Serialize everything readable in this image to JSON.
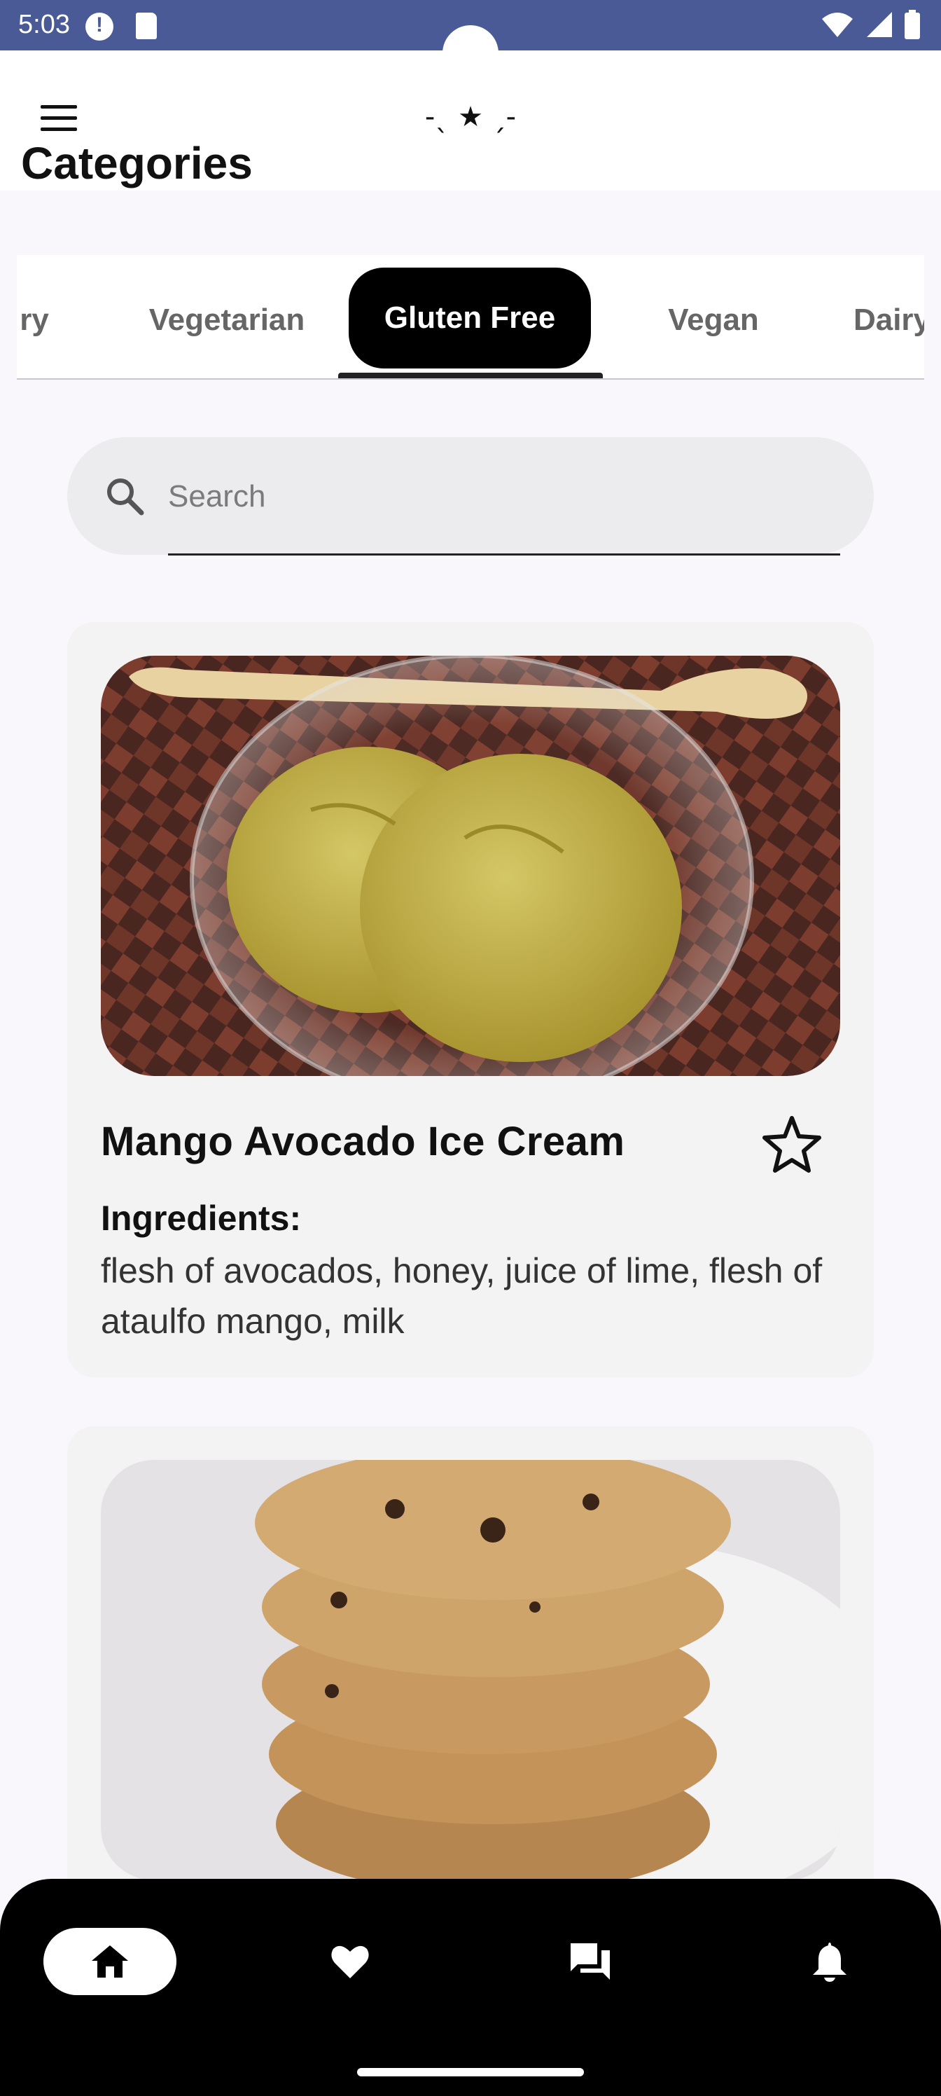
{
  "status_bar": {
    "time": "5:03",
    "icons": [
      "alert-icon",
      "sd-card-icon",
      "wifi-icon",
      "signal-icon",
      "battery-icon"
    ]
  },
  "app_bar": {
    "menu_icon": "menu-icon",
    "logo_text": "-ˎ ★ ˏ-"
  },
  "categories": {
    "title": "Categories",
    "tabs": [
      {
        "label": "ry",
        "active": false
      },
      {
        "label": "Vegetarian",
        "active": false
      },
      {
        "label": "Gluten Free",
        "active": true
      },
      {
        "label": "Vegan",
        "active": false
      },
      {
        "label": "Dairy",
        "active": false
      }
    ]
  },
  "search": {
    "placeholder": "Search",
    "icon": "search-icon"
  },
  "recipes": [
    {
      "title": "Mango Avocado Ice Cream",
      "ingredients_label": "Ingredients:",
      "ingredients": "flesh of avocados, honey, juice of lime, flesh of ataulfo mango, milk",
      "favorite_icon": "star-outline-icon"
    },
    {
      "title": "",
      "ingredients_label": "",
      "ingredients": "",
      "favorite_icon": ""
    }
  ],
  "bottom_nav": {
    "items": [
      {
        "icon": "home-icon",
        "active": true
      },
      {
        "icon": "heart-icon",
        "active": false
      },
      {
        "icon": "chat-icon",
        "active": false
      },
      {
        "icon": "bell-icon",
        "active": false
      }
    ]
  },
  "colors": {
    "status_bar": "#4a5a96",
    "active_tab": "#000000",
    "card_bg": "#f3f3f4",
    "bottom_nav": "#000000"
  }
}
